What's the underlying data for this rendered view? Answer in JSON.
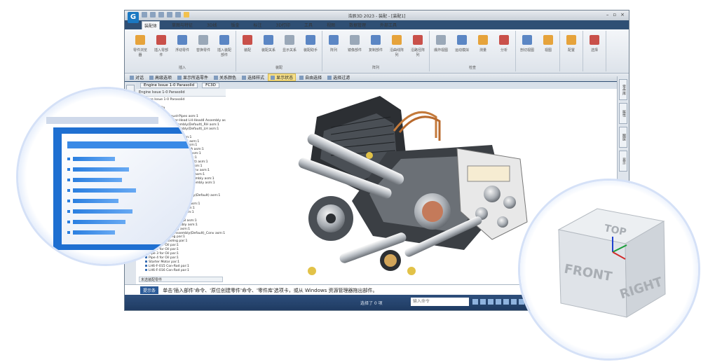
{
  "app": {
    "title": "浩辰3D 2023 - 装配 - [装配1]",
    "window_buttons": [
      "–",
      "▫",
      "×"
    ],
    "tabs": [
      "装配体",
      "草图与特征",
      "3D线",
      "钣金",
      "标注",
      "3D打印",
      "工具",
      "视图",
      "数据管理",
      "外部工具"
    ],
    "active_tab": 0,
    "ribbon_groups": [
      {
        "label": "插入",
        "buttons": [
          "零件浏览器",
          "插入零部件",
          "浮动零件",
          "替换零件",
          "插入装配部件"
        ]
      },
      {
        "label": "装配",
        "buttons": [
          "装配",
          "装配关系",
          "显示关系",
          "装配助手"
        ]
      },
      {
        "label": "阵列",
        "buttons": [
          "阵列",
          "镜像部件",
          "复制部件",
          "沿曲线阵列",
          "沿路径阵列"
        ]
      },
      {
        "label": "检查",
        "buttons": [
          "爆炸视图",
          "运动模拟",
          "测量",
          "分析"
        ]
      },
      {
        "label": "",
        "buttons": [
          "剖切视图",
          "视图"
        ]
      },
      {
        "label": "",
        "buttons": [
          "配置"
        ]
      },
      {
        "label": "",
        "buttons": [
          "选择"
        ]
      }
    ],
    "command_bar": [
      "对话",
      "高级选项",
      "显示所选零件",
      "关系颜色",
      "选择样式",
      "显示状态",
      "自由选择",
      "选择过滤"
    ],
    "command_bar_highlight": 5,
    "doc_tabs": [
      "Engine Issue 1-0 Parasolid",
      "FC3D"
    ],
    "tree_header": "Engine Issue 1-0 Parasolid",
    "tree_items": [
      "Engine Issue 1-0 Parasolid",
      "坐标系",
      "装配体_1.0a",
      "基准_1.0a",
      "Base-S13 Exhaust-Pipes asm:1",
      "Base-S13 Cylinder-Head LH-Head4 Assembly asm:1",
      "Cylinder-Head Assembly(Default)_RH asm:1",
      "Cylinder-Head Assembly(Default)_LH asm:1",
      "Front Assembly asm:1",
      "Rear Inlet Assembly asm:1",
      "Cam cover Assembly_LH asm:1",
      "Inlet Exhaust Assembly asm:1",
      "Outlet Exhaust Assembly_A asm:1",
      "Inlet Exhaust Assembly_B asm:1",
      "Engine Block Assembly asm:1",
      "Crankshaft Assembly(Default) asm:1",
      "Main Crankshaft Assembly asm:1",
      "Crank Assembly(Default)_Conv asm:1",
      "Oil Pump Assembly(Default) asm:1",
      "Side Pump for Pushrods Assembly asm:1",
      "Main Pump for Pushrods Assembly asm:1",
      "Camshaft Assembly asm:1",
      "Lifter Assembly asm:1",
      "Pushrod (Pu-Head) Assembly(Default) asm:1",
      "Rocker Assembly asm:1",
      "Valve Spring Assembly_A asm:1",
      "Front Cover Assembly asm:1",
      "Rear Cover Assembly asm:1",
      "Head Assembly asm:1",
      "Crankcase Assembly_B asm:1",
      "Fuel-Injection Assembly asm:1",
      "Gear-Set Assembly asm:1",
      "Camshaft-Shaft Assembly(Default)_Conv asm:1",
      "Pipe Left Cooling par:1",
      "Pipe Right Cooling par:1",
      "Pipe 1 for Oil par:1",
      "Pipe 2 for Oil par:1",
      "Pipe 3 for Oil par:1",
      "Pipe 4 for Oil par:1",
      "Starter Motor par:1",
      "LH6-F-015 Con-Rod par:1",
      "LH6-F-016 Con-Rod par:1"
    ],
    "tree_footer": "未选装配零件",
    "status_badge": "提示条",
    "status_text": "单击'插入部件'命令、'原位创建零件'命令、'零件库'选项卡，或从 Windows 资源管理器拖出部件。",
    "coord_text": "选择了 0 项",
    "command_input_placeholder": "输入命令",
    "right_strip_buttons": [
      "零件库",
      "属性",
      "图层",
      "显示"
    ]
  },
  "view_cube": {
    "top": "TOP",
    "front": "FRONT",
    "right": "RIGHT"
  },
  "colors": {
    "accent": "#2a5a98",
    "highlight": "#f6e08a",
    "lens_ring": "#c6d6f4"
  }
}
